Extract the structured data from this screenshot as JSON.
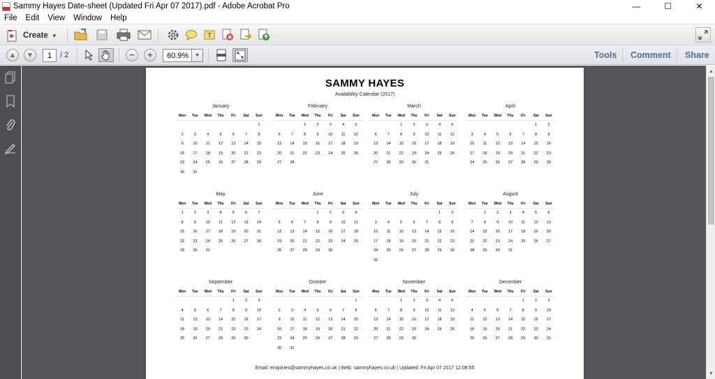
{
  "window": {
    "title": "Sammy Hayes Date-sheet (Updated Fri Apr 07 2017).pdf - Adobe Acrobat Pro",
    "minimize": "—",
    "maximize": "☐",
    "close": "✕"
  },
  "menu": [
    "File",
    "Edit",
    "View",
    "Window",
    "Help"
  ],
  "toolbar": {
    "create_label": "Create",
    "icons": [
      "open-icon",
      "save-icon",
      "print-icon",
      "email-icon",
      "settings-icon",
      "comment-icon",
      "highlight-icon",
      "delete-icon",
      "export-icon",
      "share-icon",
      "expand-icon"
    ]
  },
  "nav": {
    "page_current": "1",
    "page_total": "/ 2",
    "zoom": "60.9%",
    "tools_label": "Tools",
    "comment_label": "Comment",
    "share_label": "Share"
  },
  "document": {
    "title": "SAMMY HAYES",
    "subtitle": "Availability Calendar (2017)",
    "weekdays": [
      "Mon",
      "Tue",
      "Wed",
      "Thu",
      "Fri",
      "Sat",
      "Sun"
    ],
    "months": [
      {
        "name": "January",
        "offset": 6,
        "days": 31
      },
      {
        "name": "February",
        "offset": 2,
        "days": 28
      },
      {
        "name": "March",
        "offset": 2,
        "days": 31
      },
      {
        "name": "April",
        "offset": 5,
        "days": 30
      },
      {
        "name": "May",
        "offset": 0,
        "days": 31
      },
      {
        "name": "June",
        "offset": 3,
        "days": 30
      },
      {
        "name": "July",
        "offset": 5,
        "days": 31
      },
      {
        "name": "August",
        "offset": 1,
        "days": 31
      },
      {
        "name": "September",
        "offset": 4,
        "days": 30
      },
      {
        "name": "October",
        "offset": 6,
        "days": 31
      },
      {
        "name": "November",
        "offset": 2,
        "days": 30
      },
      {
        "name": "December",
        "offset": 4,
        "days": 31
      }
    ],
    "footer": "Email: enquiries@sammyhayes.co.uk   |   Web: sammyhayes.co.uk   |   Updated: Fri Apr 07 2017 12:08:55"
  },
  "colors": {
    "right_links": "#4f6e91",
    "doc_background": "#545659",
    "left_panel": "#4b4e53"
  }
}
